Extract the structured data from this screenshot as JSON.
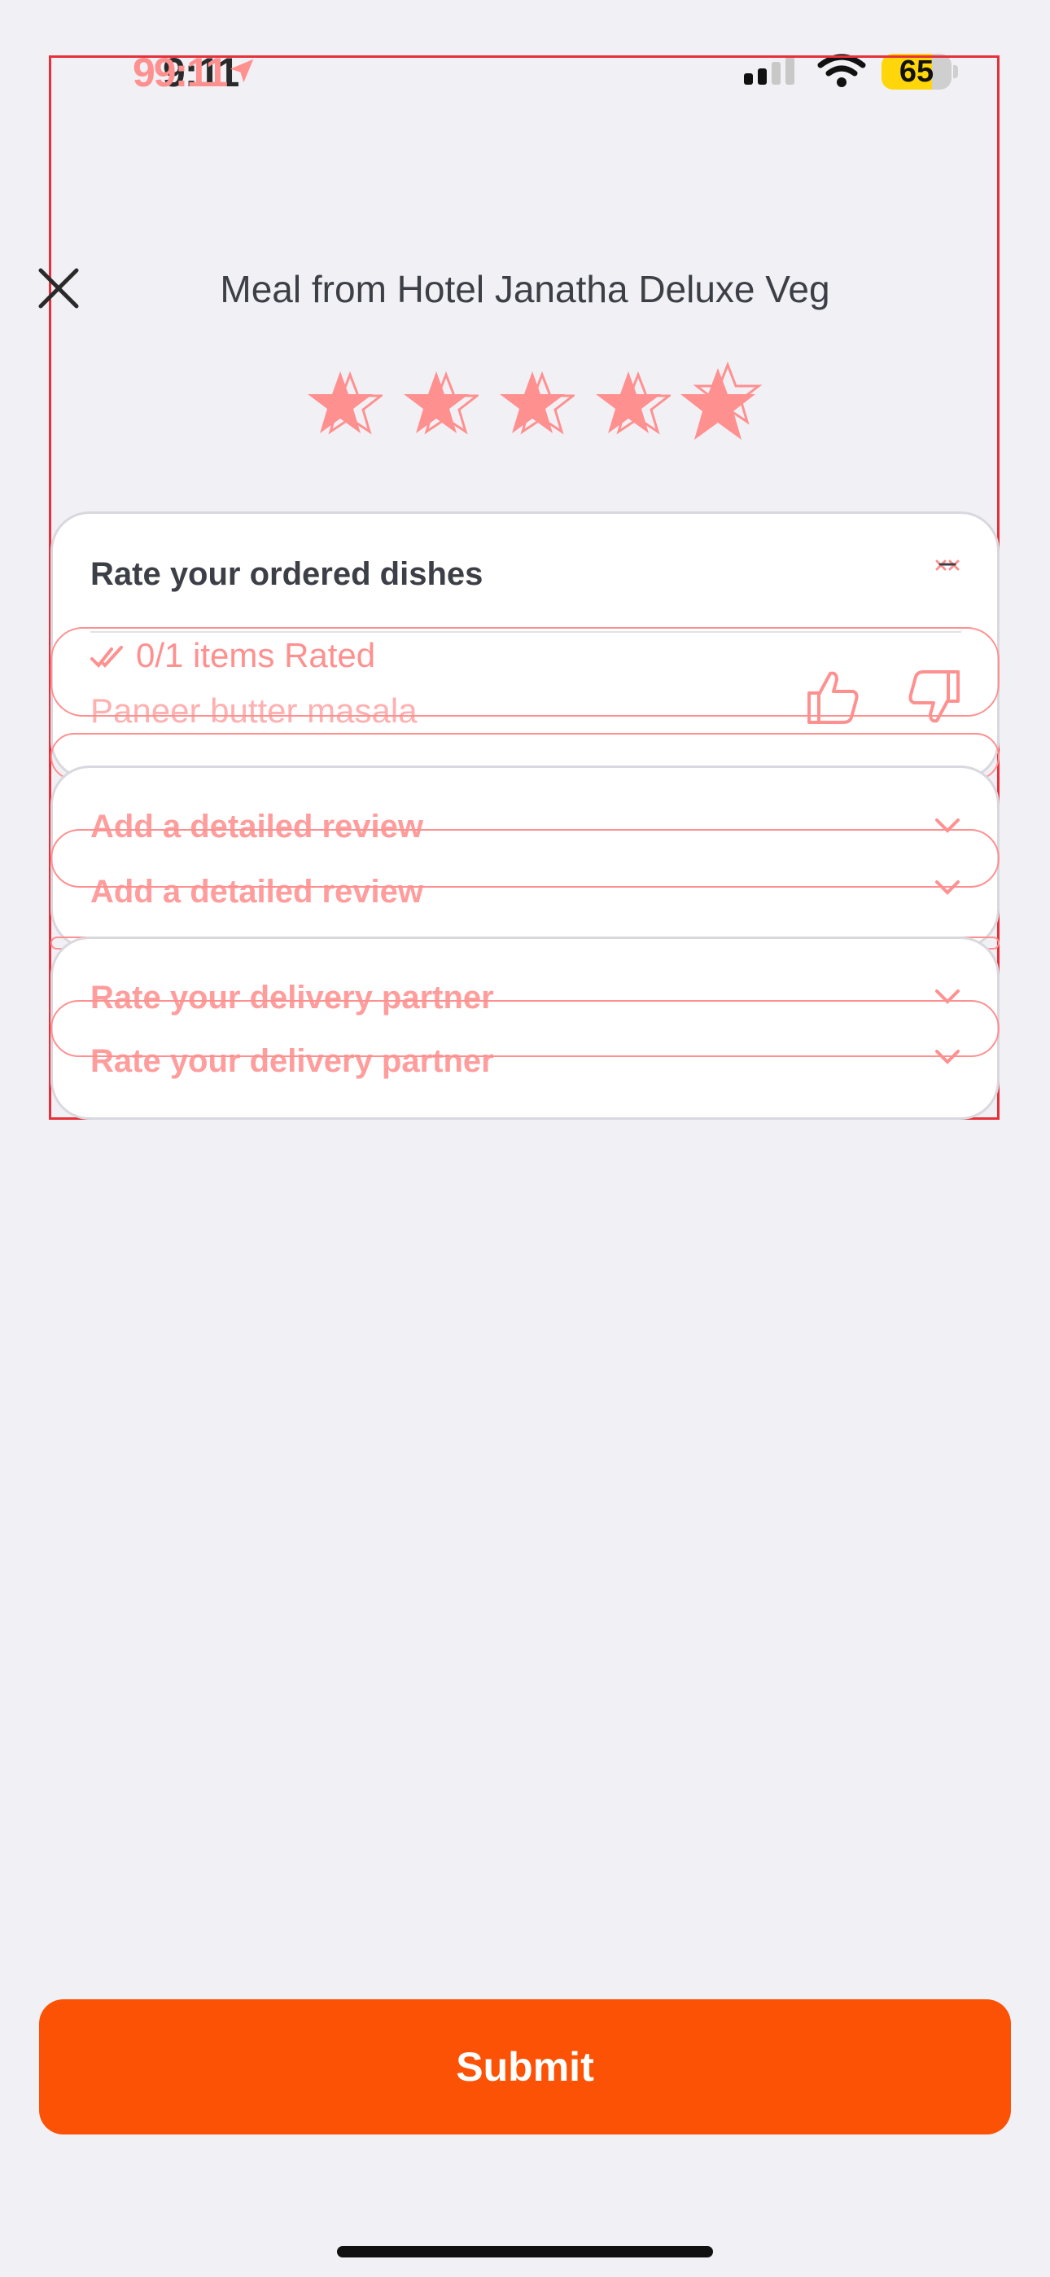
{
  "status_bar": {
    "time": "9:11",
    "time_overlay": "99:11",
    "battery": "65"
  },
  "header": {
    "title": "Meal from Hotel Janatha Deluxe Veg",
    "rating_stars": 5
  },
  "dishes_card": {
    "title": "Rate your ordered dishes",
    "rated_status": "0/1 items Rated",
    "dish_name": "Paneer butter masala"
  },
  "review_section": {
    "label": "Add a detailed review",
    "label_ghost": "Add a detailed review"
  },
  "delivery_section": {
    "label": "Rate your delivery partner",
    "label_ghost": "Rate your delivery partner"
  },
  "actions": {
    "submit_label": "Submit"
  },
  "colors": {
    "accent": "#fc5205",
    "overlay_pink": "#ff9090",
    "background": "#f0f0f5"
  }
}
